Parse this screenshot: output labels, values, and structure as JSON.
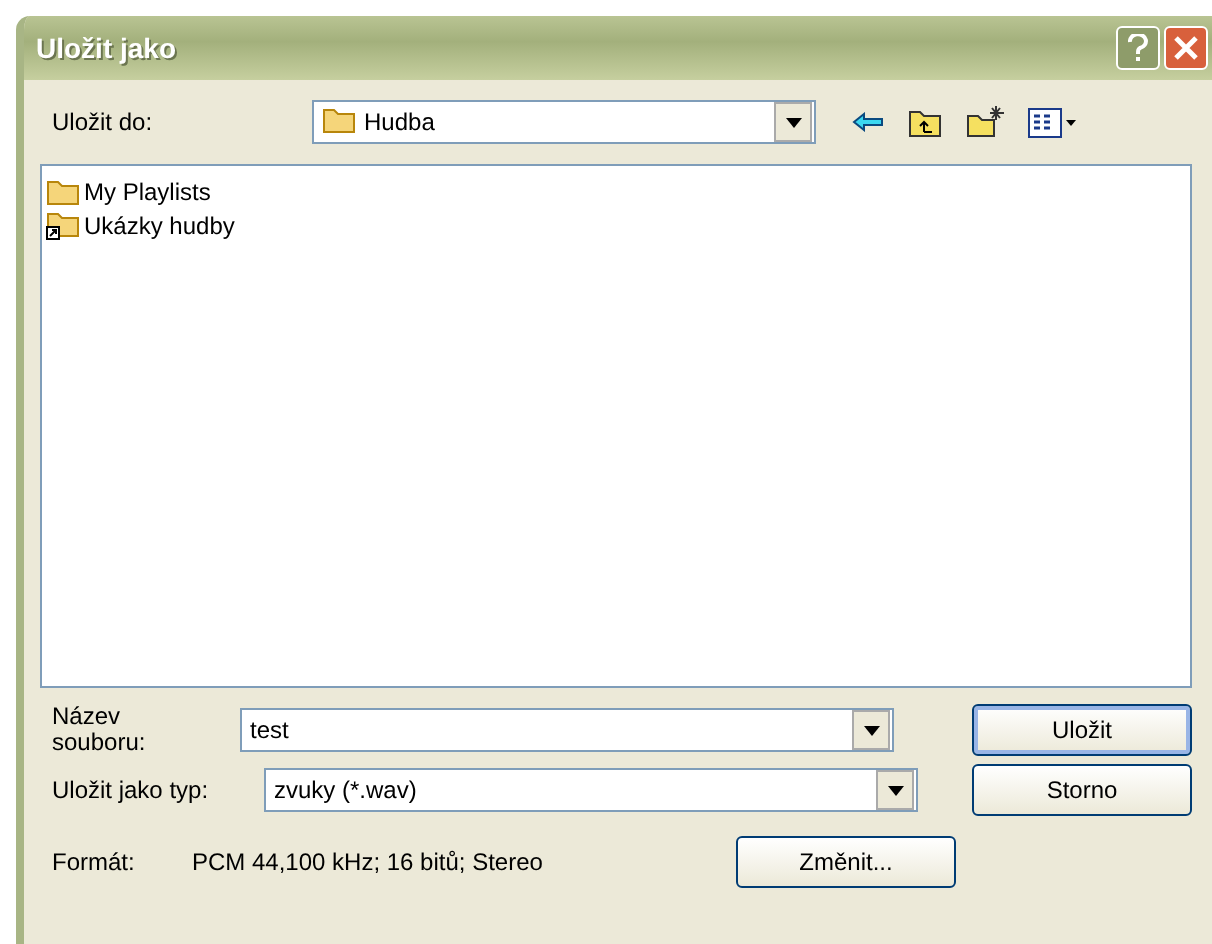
{
  "window": {
    "title": "Uložit jako"
  },
  "location": {
    "label": "Uložit do:",
    "value": "Hudba"
  },
  "files": [
    {
      "name": "My Playlists",
      "kind": "folder"
    },
    {
      "name": "Ukázky hudby",
      "kind": "shortcut"
    }
  ],
  "file_name": {
    "label": "Název souboru:",
    "value": "test"
  },
  "file_type": {
    "label": "Uložit jako typ:",
    "value": "zvuky (*.wav)"
  },
  "format": {
    "label": "Formát:",
    "value": "PCM 44,100 kHz; 16 bitů; Stereo"
  },
  "buttons": [
    {
      "label": "Uložit",
      "kind": "save"
    },
    {
      "label": "Storno",
      "kind": "cancel"
    },
    {
      "label": "Změnit...",
      "kind": "change"
    }
  ]
}
